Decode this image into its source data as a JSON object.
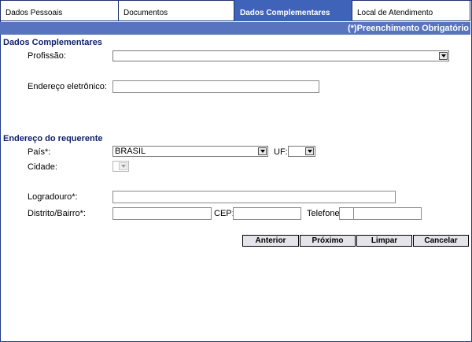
{
  "tabs": [
    {
      "label": "Dados Pessoais"
    },
    {
      "label": "Documentos"
    },
    {
      "label": "Dados Complementares"
    },
    {
      "label": "Local de Atendimento"
    }
  ],
  "header": {
    "required_note": "(*)Preenchimento Obrigatório"
  },
  "complementares": {
    "title": "Dados Complementares",
    "profissao_label": "Profissão:",
    "profissao_value": "",
    "email_label": "Endereço eletrônico:",
    "email_value": ""
  },
  "endereco": {
    "title": "Endereço do requerente",
    "pais_label": "País*:",
    "pais_value": "BRASIL",
    "uf_label": "UF:",
    "uf_value": "",
    "cidade_label": "Cidade:",
    "cidade_value": "",
    "logradouro_label": "Logradouro*:",
    "logradouro_value": "",
    "bairro_label": "Distrito/Bairro*:",
    "bairro_value": "",
    "cep_label": "CEP:",
    "cep_value": "",
    "telefone_label": "Telefone:",
    "ddd_value": "",
    "telefone_value": ""
  },
  "buttons": {
    "anterior": "Anterior",
    "proximo": "Próximo",
    "limpar": "Limpar",
    "cancelar": "Cancelar"
  },
  "colors": {
    "active_tab": "#3f63b8",
    "header_bar": "#5873c0",
    "section_title": "#11216a"
  }
}
